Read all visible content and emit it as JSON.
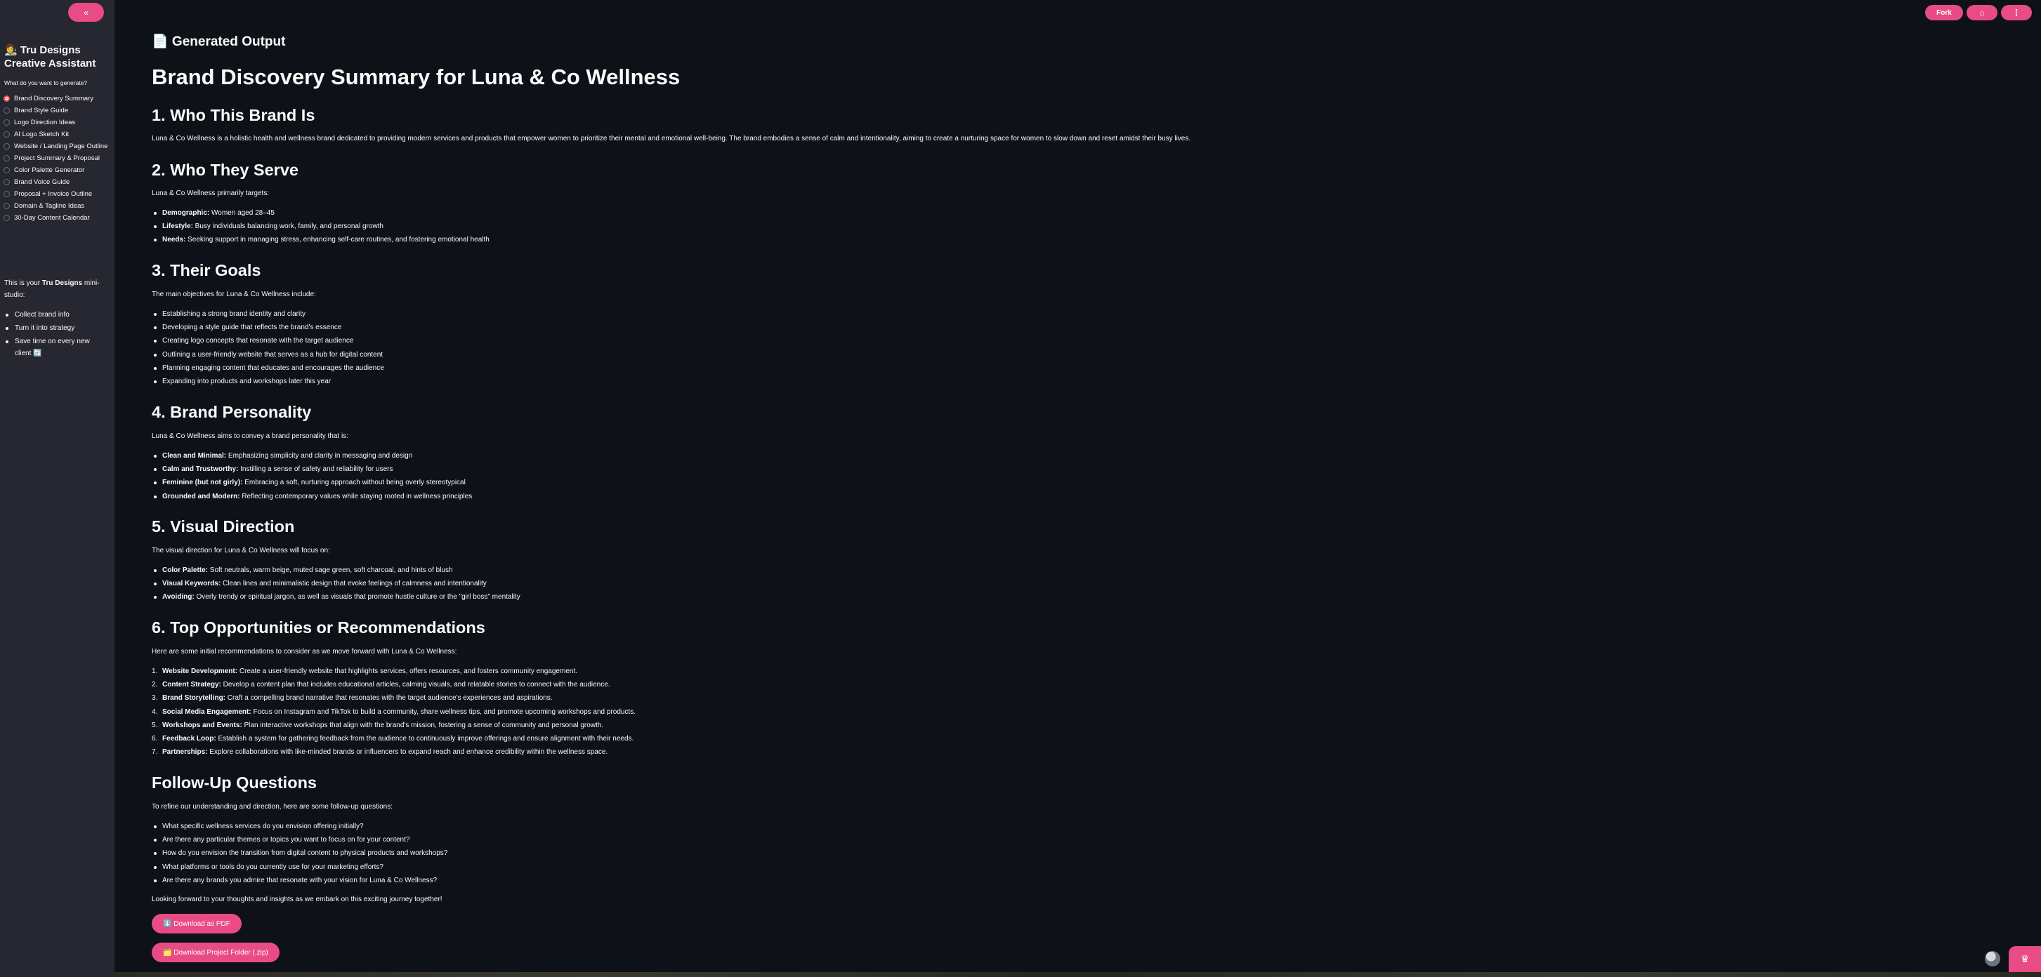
{
  "sidebar": {
    "collapse_icon": "«",
    "title_emoji": "👩‍🎨",
    "title": "Tru Designs Creative Assistant",
    "prompt": "What do you want to generate?",
    "options": [
      "Brand Discovery Summary",
      "Brand Style Guide",
      "Logo Direction Ideas",
      "AI Logo Sketch Kit",
      "Website / Landing Page Outline",
      "Project Summary & Proposal",
      "Color Palette Generator",
      "Brand Voice Guide",
      "Proposal + Invoice Outline",
      "Domain & Tagline Ideas",
      "30-Day Content Calendar"
    ],
    "selected_index": 0,
    "note_prefix": "This is your ",
    "note_bold": "Tru Designs",
    "note_suffix": " mini-studio:",
    "bullets": [
      "Collect brand info",
      "Turn it into strategy",
      "Save time on every new client 🔄"
    ]
  },
  "topbar": {
    "fork_label": "Fork",
    "github_icon": "⌂",
    "menu_icon": "⋮"
  },
  "main": {
    "generated_heading": "📄 Generated Output",
    "title": "Brand Discovery Summary for Luna & Co Wellness",
    "s1": {
      "heading": "1. Who This Brand Is",
      "text": "Luna & Co Wellness is a holistic health and wellness brand dedicated to providing modern services and products that empower women to prioritize their mental and emotional well-being. The brand embodies a sense of calm and intentionality, aiming to create a nurturing space for women to slow down and reset amidst their busy lives."
    },
    "s2": {
      "heading": "2. Who They Serve",
      "intro": "Luna & Co Wellness primarily targets:",
      "items": [
        {
          "label": "Demographic:",
          "text": " Women aged 28–45"
        },
        {
          "label": "Lifestyle:",
          "text": " Busy individuals balancing work, family, and personal growth"
        },
        {
          "label": "Needs:",
          "text": " Seeking support in managing stress, enhancing self-care routines, and fostering emotional health"
        }
      ]
    },
    "s3": {
      "heading": "3. Their Goals",
      "intro": "The main objectives for Luna & Co Wellness include:",
      "items": [
        "Establishing a strong brand identity and clarity",
        "Developing a style guide that reflects the brand's essence",
        "Creating logo concepts that resonate with the target audience",
        "Outlining a user-friendly website that serves as a hub for digital content",
        "Planning engaging content that educates and encourages the audience",
        "Expanding into products and workshops later this year"
      ]
    },
    "s4": {
      "heading": "4. Brand Personality",
      "intro": "Luna & Co Wellness aims to convey a brand personality that is:",
      "items": [
        {
          "label": "Clean and Minimal:",
          "text": " Emphasizing simplicity and clarity in messaging and design"
        },
        {
          "label": "Calm and Trustworthy:",
          "text": " Instilling a sense of safety and reliability for users"
        },
        {
          "label": "Feminine (but not girly):",
          "text": " Embracing a soft, nurturing approach without being overly stereotypical"
        },
        {
          "label": "Grounded and Modern:",
          "text": " Reflecting contemporary values while staying rooted in wellness principles"
        }
      ]
    },
    "s5": {
      "heading": "5. Visual Direction",
      "intro": "The visual direction for Luna & Co Wellness will focus on:",
      "items": [
        {
          "label": "Color Palette:",
          "text": " Soft neutrals, warm beige, muted sage green, soft charcoal, and hints of blush"
        },
        {
          "label": "Visual Keywords:",
          "text": " Clean lines and minimalistic design that evoke feelings of calmness and intentionality"
        },
        {
          "label": "Avoiding:",
          "text": " Overly trendy or spiritual jargon, as well as visuals that promote hustle culture or the \"girl boss\" mentality"
        }
      ]
    },
    "s6": {
      "heading": "6. Top Opportunities or Recommendations",
      "intro": "Here are some initial recommendations to consider as we move forward with Luna & Co Wellness:",
      "items": [
        {
          "label": "Website Development:",
          "text": " Create a user-friendly website that highlights services, offers resources, and fosters community engagement."
        },
        {
          "label": "Content Strategy:",
          "text": " Develop a content plan that includes educational articles, calming visuals, and relatable stories to connect with the audience."
        },
        {
          "label": "Brand Storytelling:",
          "text": " Craft a compelling brand narrative that resonates with the target audience's experiences and aspirations."
        },
        {
          "label": "Social Media Engagement:",
          "text": " Focus on Instagram and TikTok to build a community, share wellness tips, and promote upcoming workshops and products."
        },
        {
          "label": "Workshops and Events:",
          "text": " Plan interactive workshops that align with the brand's mission, fostering a sense of community and personal growth."
        },
        {
          "label": "Feedback Loop:",
          "text": " Establish a system for gathering feedback from the audience to continuously improve offerings and ensure alignment with their needs."
        },
        {
          "label": "Partnerships:",
          "text": " Explore collaborations with like-minded brands or influencers to expand reach and enhance credibility within the wellness space."
        }
      ]
    },
    "s7": {
      "heading": "Follow-Up Questions",
      "intro": "To refine our understanding and direction, here are some follow-up questions:",
      "items": [
        "What specific wellness services do you envision offering initially?",
        "Are there any particular themes or topics you want to focus on for your content?",
        "How do you envision the transition from digital content to physical products and workshops?",
        "What platforms or tools do you currently use for your marketing efforts?",
        "Are there any brands you admire that resonate with your vision for Luna & Co Wellness?"
      ],
      "closing": "Looking forward to your thoughts and insights as we embark on this exciting journey together!"
    },
    "download_pdf": "⬇️ Download as PDF",
    "download_zip": "🗂️ Download Project Folder (.zip)"
  },
  "colors": {
    "accent": "#e94b84",
    "background": "#0e1117",
    "sidebar": "#262730",
    "radio_selected": "#ff4b4b"
  },
  "footer": {
    "badge_icon": "crown-icon"
  }
}
